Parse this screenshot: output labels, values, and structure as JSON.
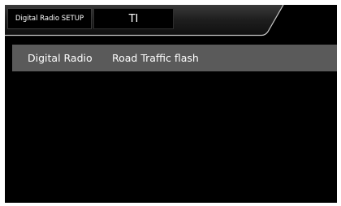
{
  "header": {
    "setup_tab_label": "Digital Radio SETUP",
    "page_title": "TI"
  },
  "settings": {
    "items": [
      {
        "label": "Digital Radio",
        "value": "Road Traffic flash"
      }
    ]
  },
  "colors": {
    "background": "#000000",
    "row_background": "#5a5a5a",
    "text": "#ffffff",
    "header_accent": "#c8c8c8"
  }
}
